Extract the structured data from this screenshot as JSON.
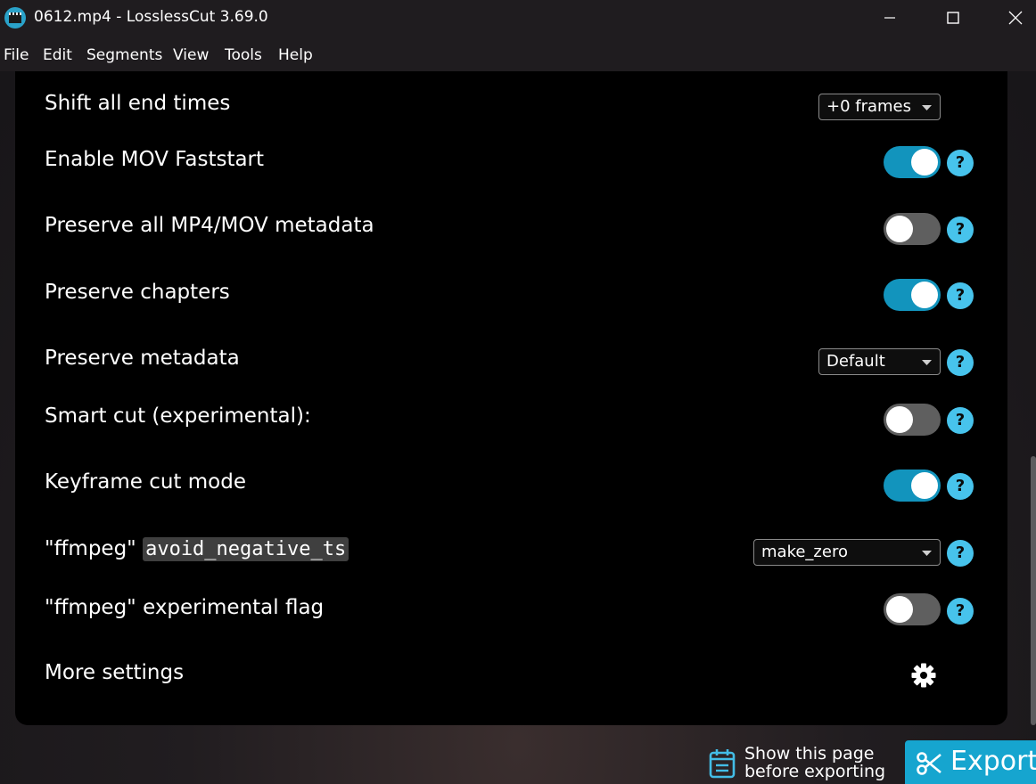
{
  "window": {
    "title": "0612.mp4 - LosslessCut 3.69.0"
  },
  "menu": [
    {
      "label": "File"
    },
    {
      "label": "Edit"
    },
    {
      "label": "Segments"
    },
    {
      "label": "View"
    },
    {
      "label": "Tools"
    },
    {
      "label": "Help"
    }
  ],
  "settings": {
    "shift_end_times": {
      "label": "Shift all end times",
      "value": "+0 frames"
    },
    "mov_faststart": {
      "label": "Enable MOV Faststart",
      "enabled": true
    },
    "preserve_mp4_metadata": {
      "label": "Preserve all MP4/MOV metadata",
      "enabled": false
    },
    "preserve_chapters": {
      "label": "Preserve chapters",
      "enabled": true
    },
    "preserve_metadata": {
      "label": "Preserve metadata",
      "value": "Default"
    },
    "smart_cut": {
      "label": "Smart cut (experimental):",
      "enabled": false
    },
    "keyframe_cut": {
      "label": "Keyframe cut mode",
      "enabled": true
    },
    "avoid_negative_ts": {
      "label_prefix": "\"ffmpeg\" ",
      "code": "avoid_negative_ts",
      "value": "make_zero"
    },
    "experimental_flag": {
      "label": "\"ffmpeg\" experimental flag",
      "enabled": false
    },
    "more_settings": {
      "label": "More settings"
    }
  },
  "help_symbol": "?",
  "footer": {
    "show_page_line1": "Show this page",
    "show_page_line2": "before exporting",
    "export_label": "Export"
  },
  "colors": {
    "accent": "#1294bd",
    "help_badge": "#47c3ec",
    "export_button": "#16a5cf",
    "toggle_off": "#5f5f5f"
  },
  "icons": {
    "app": "clapperboard-icon",
    "minimize": "minimize-icon",
    "maximize": "maximize-icon",
    "close": "close-icon",
    "settings": "gear-icon",
    "show_page": "calendar-icon",
    "export": "scissors-icon"
  }
}
